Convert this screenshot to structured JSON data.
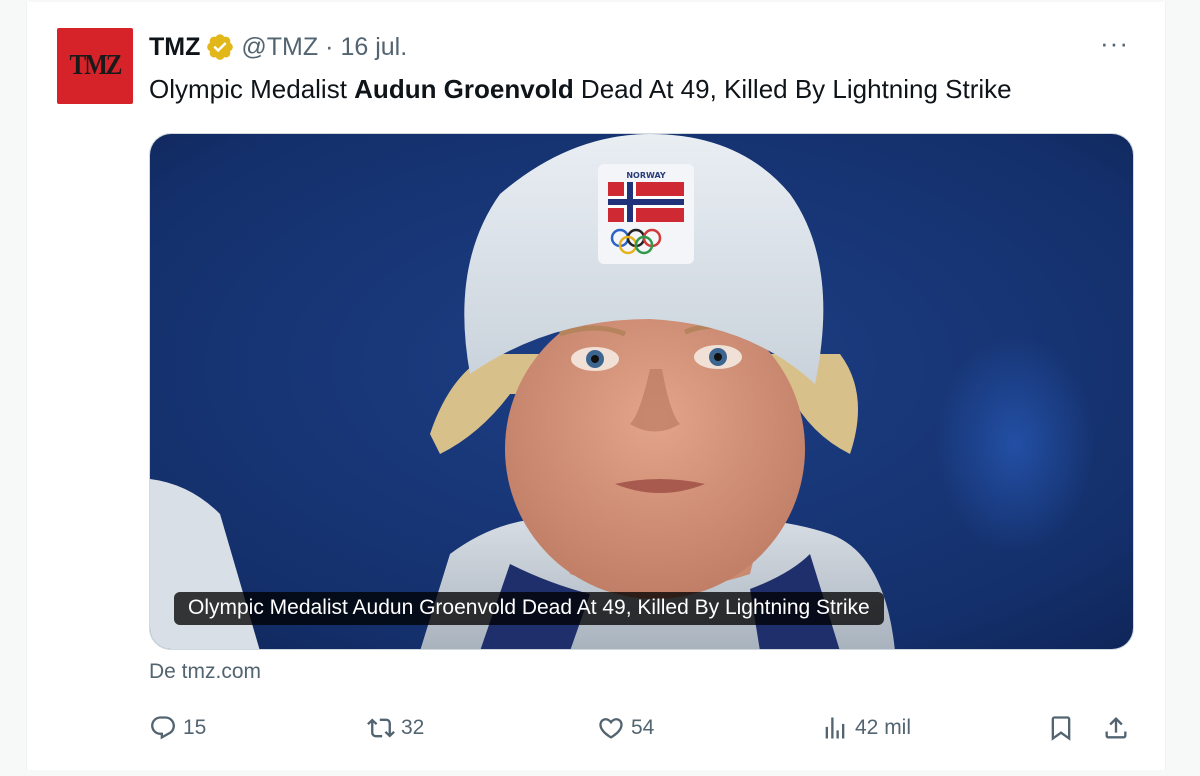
{
  "tweet": {
    "author": {
      "avatar_text": "TMZ",
      "name": "TMZ",
      "handle": "@TMZ",
      "separator": "·",
      "date": "16 jul.",
      "verified_color": "#e2b719"
    },
    "more_label": "···",
    "text": {
      "before": "Olympic Medalist ",
      "bold": "Audun Groenvold",
      "after": " Dead At 49, Killed By Lightning Strike"
    },
    "media": {
      "caption": "Olympic Medalist Audun Groenvold Dead At 49, Killed By Lightning Strike",
      "hat_text": "NORWAY"
    },
    "source": "De tmz.com",
    "actions": {
      "replies": "15",
      "retweets": "32",
      "likes": "54",
      "views": "42 mil"
    }
  },
  "colors": {
    "brand_red": "#d6232a",
    "text_primary": "#0f1419",
    "text_secondary": "#536471"
  }
}
